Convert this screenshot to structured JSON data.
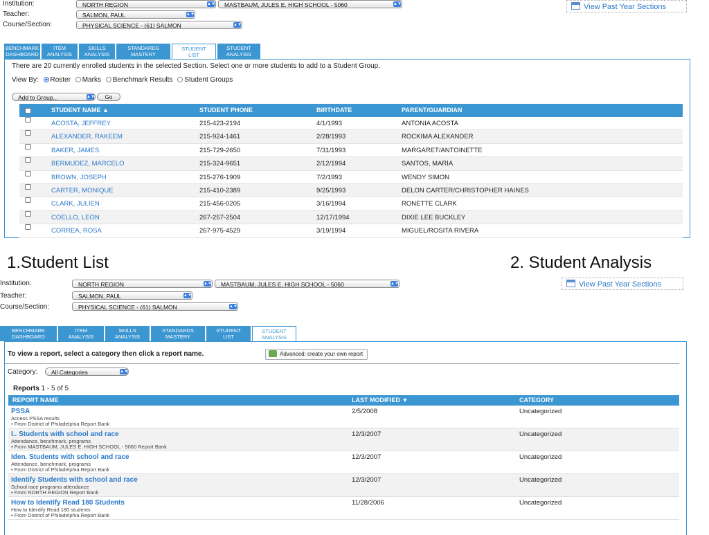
{
  "filters": {
    "institution_label": "Institution:",
    "teacher_label": "Teacher:",
    "course_label": "Course/Section:",
    "region": "NORTH REGION",
    "school": "MASTBAUM, JULES E. HIGH SCHOOL - 5060",
    "teacher": "SALMON, PAUL",
    "course": "PHYSICAL SCIENCE - (61) SALMON",
    "past_year": "View Past Year Sections"
  },
  "tabs": [
    {
      "line1": "BENCHMARK",
      "line2": "DASHBOARD"
    },
    {
      "line1": "ITEM",
      "line2": "ANALYSIS"
    },
    {
      "line1": "SKILLS",
      "line2": "ANALYSIS"
    },
    {
      "line1": "STANDARDS",
      "line2": "MASTERY"
    },
    {
      "line1": "STUDENT",
      "line2": "LIST"
    },
    {
      "line1": "STUDENT",
      "line2": "ANALYSIS"
    }
  ],
  "student_list": {
    "info": "There are 20 currently enrolled students in the selected Section. Select one or more students to add to a Student Group.",
    "view_by_label": "View By:",
    "view_options": [
      "Roster",
      "Marks",
      "Benchmark Results",
      "Student Groups"
    ],
    "add_to_group": "Add to Group...",
    "go": "Go",
    "columns": {
      "name": "STUDENT NAME ▲",
      "phone": "STUDENT PHONE",
      "birthdate": "BIRTHDATE",
      "parent": "PARENT/GUARDIAN"
    },
    "rows": [
      {
        "name": "ACOSTA, JEFFREY",
        "phone": "215-423-2194",
        "birthdate": "4/1/1993",
        "parent": "ANTONIA ACOSTA"
      },
      {
        "name": "ALEXANDER, RAKEEM",
        "phone": "215-924-1461",
        "birthdate": "2/28/1993",
        "parent": "ROCKIMA ALEXANDER"
      },
      {
        "name": "BAKER, JAMES",
        "phone": "215-729-2650",
        "birthdate": "7/31/1993",
        "parent": "MARGARET/ANTOINETTE"
      },
      {
        "name": "BERMUDEZ, MARCELO",
        "phone": "215-324-9651",
        "birthdate": "2/12/1994",
        "parent": "SANTOS, MARIA"
      },
      {
        "name": "BROWN, JOSEPH",
        "phone": "215-276-1909",
        "birthdate": "7/2/1993",
        "parent": "WENDY SIMON"
      },
      {
        "name": "CARTER, MONIQUE",
        "phone": "215-410-2389",
        "birthdate": "9/25/1993",
        "parent": "DELON CARTER/CHRISTOPHER HAINES"
      },
      {
        "name": "CLARK, JULIEN",
        "phone": "215-456-0205",
        "birthdate": "3/16/1994",
        "parent": "RONETTE CLARK"
      },
      {
        "name": "COELLO, LEON",
        "phone": "267-257-2504",
        "birthdate": "12/17/1994",
        "parent": "DIXIE LEE BUCKLEY"
      },
      {
        "name": "CORREA, ROSA",
        "phone": "267-975-4529",
        "birthdate": "3/19/1994",
        "parent": "MIGUEL/ROSITA RIVERA"
      }
    ]
  },
  "captions": {
    "left": "1.Student List",
    "right": "2. Student Analysis"
  },
  "student_analysis": {
    "intro": "To view a report, select a category then click a report name.",
    "advanced": "Advanced: create your own report",
    "category_label": "Category:",
    "category_value": "All Categories",
    "reports_label": "Reports",
    "reports_count": "1 - 5 of 5",
    "columns": {
      "name": "REPORT NAME",
      "modified": "LAST MODIFIED ▼",
      "category": "CATEGORY"
    },
    "rows": [
      {
        "name": "PSSA",
        "desc": "Access PSSA results",
        "source": "• From District of Philadelphia Report Bank",
        "modified": "2/5/2008",
        "category": "Uncategorized"
      },
      {
        "name": "I.. Students with school and race",
        "desc": "Attendance, benchmark, programs",
        "source": "• From MASTBAUM, JULES E. HIGH SCHOOL - 5060 Report Bank",
        "modified": "12/3/2007",
        "category": "Uncategorized"
      },
      {
        "name": "Iden. Students with school and race",
        "desc": "Attendance, benchmark, programs",
        "source": "• From District of Philadelphia Report Bank",
        "modified": "12/3/2007",
        "category": "Uncategorized"
      },
      {
        "name": "Identify Students with school and race",
        "desc": "School race programs attendance",
        "source": "• From NORTH REGION Report Bank",
        "modified": "12/3/2007",
        "category": "Uncategorized"
      },
      {
        "name": "How to Identify Read 180 Students",
        "desc": "How to Identify Read 180 students",
        "source": "• From District of Philadelphia Report Bank",
        "modified": "11/28/2006",
        "category": "Uncategorized"
      }
    ]
  }
}
